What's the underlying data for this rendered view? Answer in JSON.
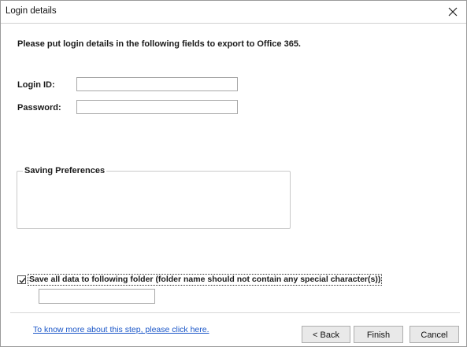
{
  "window": {
    "title": "Login details"
  },
  "form": {
    "instruction": "Please put login details in the following fields to export to Office 365.",
    "login_id_label": "Login ID:",
    "login_id_value": "",
    "password_label": "Password:",
    "password_value": ""
  },
  "saving_preferences": {
    "legend": "Saving Preferences"
  },
  "folder_option": {
    "checked": true,
    "label": "Save all data to following folder (folder name should not contain any special character(s))",
    "folder_value": ""
  },
  "footer": {
    "help_link": "To know more about this step, please click here.",
    "back_label": "< Back",
    "finish_label": "Finish",
    "cancel_label": "Cancel"
  },
  "icons": {
    "close": "close-icon",
    "checkmark": "checkmark-icon"
  }
}
